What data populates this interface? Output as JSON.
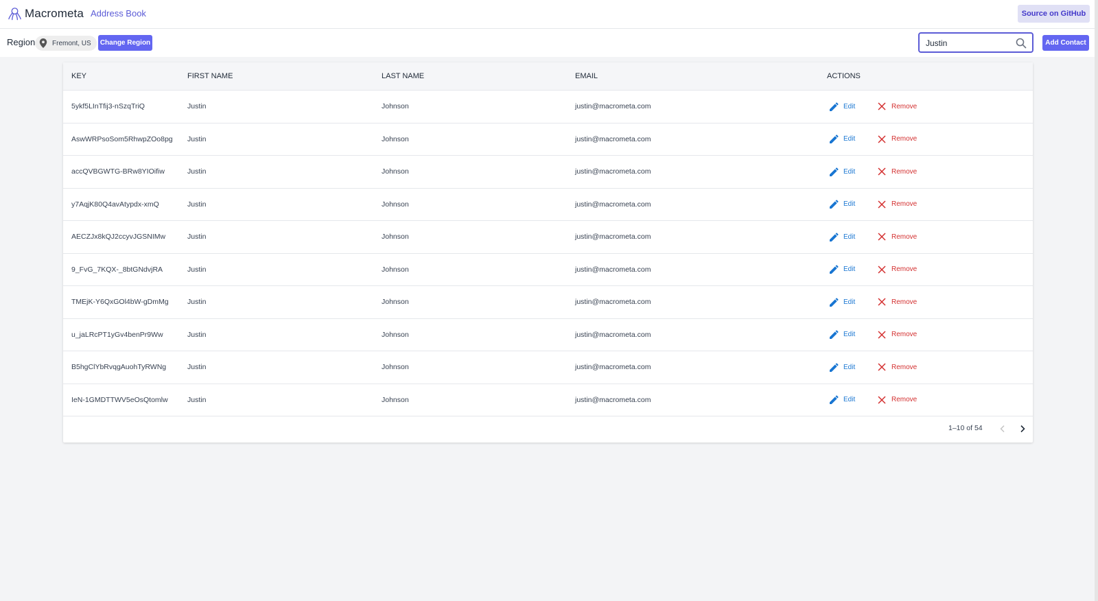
{
  "header": {
    "logo_text": "Macrometa",
    "app_title": "Address Book",
    "github_label": "Source on GitHub"
  },
  "toolbar": {
    "region_label": "Region:",
    "region_value": "Fremont, US",
    "change_region_label": "Change Region",
    "search_value": "Justin",
    "add_contact_label": "Add Contact"
  },
  "table": {
    "headers": {
      "key": "KEY",
      "first_name": "FIRST NAME",
      "last_name": "LAST NAME",
      "email": "EMAIL",
      "actions": "ACTIONS"
    },
    "edit_label": "Edit",
    "remove_label": "Remove",
    "rows": [
      {
        "key": "5ykf5LInTfij3-nSzqTriQ",
        "first": "Justin",
        "last": "Johnson",
        "email": "justin@macrometa.com"
      },
      {
        "key": "AswWRPsoSom5RhwpZOo8pg",
        "first": "Justin",
        "last": "Johnson",
        "email": "justin@macrometa.com"
      },
      {
        "key": "accQVBGWTG-BRw8YIOifiw",
        "first": "Justin",
        "last": "Johnson",
        "email": "justin@macrometa.com"
      },
      {
        "key": "y7AqjK80Q4avAtypdx-xmQ",
        "first": "Justin",
        "last": "Johnson",
        "email": "justin@macrometa.com"
      },
      {
        "key": "AECZJx8kQJ2ccyvJGSNIMw",
        "first": "Justin",
        "last": "Johnson",
        "email": "justin@macrometa.com"
      },
      {
        "key": "9_FvG_7KQX-_8btGNdvjRA",
        "first": "Justin",
        "last": "Johnson",
        "email": "justin@macrometa.com"
      },
      {
        "key": "TMEjK-Y6QxGOl4bW-gDmMg",
        "first": "Justin",
        "last": "Johnson",
        "email": "justin@macrometa.com"
      },
      {
        "key": "u_jaLRcPT1yGv4benPr9Ww",
        "first": "Justin",
        "last": "Johnson",
        "email": "justin@macrometa.com"
      },
      {
        "key": "B5hgClYbRvqgAuohTyRWNg",
        "first": "Justin",
        "last": "Johnson",
        "email": "justin@macrometa.com"
      },
      {
        "key": "IeN-1GMDTTWV5eOsQtomlw",
        "first": "Justin",
        "last": "Johnson",
        "email": "justin@macrometa.com"
      }
    ]
  },
  "pagination": {
    "info": "1–10 of 54"
  },
  "icons": {
    "logo": "octopus-logo-icon",
    "region": "location-pin-icon",
    "search": "search-icon",
    "edit": "pencil-icon",
    "remove": "close-icon",
    "prev": "chevron-left-icon",
    "next": "chevron-right-icon"
  },
  "colors": {
    "accent": "#6366f1",
    "title": "#5b5bd6",
    "edit": "#1976d2",
    "remove": "#d32f2f"
  }
}
